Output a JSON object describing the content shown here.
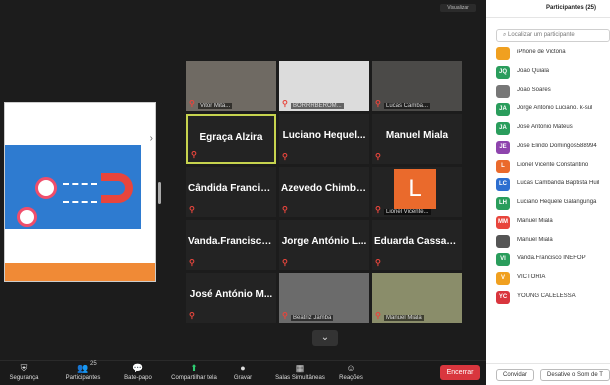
{
  "window": {
    "top_badge": "Visualizar"
  },
  "tiles": [
    {
      "name": "",
      "label": "Vitor Mita...",
      "type": "photo"
    },
    {
      "name": "",
      "label": "BORRRBEROM...",
      "type": "photo"
    },
    {
      "name": "",
      "label": "Lucas Camba...",
      "type": "photo"
    },
    {
      "name": "Egraça Alzira",
      "label": "",
      "type": "text"
    },
    {
      "name": "Luciano  Hequel...",
      "label": "",
      "type": "text"
    },
    {
      "name": "Manuel Miala",
      "label": "",
      "type": "text"
    },
    {
      "name": "Cândida Francisco",
      "label": "",
      "type": "text"
    },
    {
      "name": "Azevedo Chimbau",
      "label": "",
      "type": "text"
    },
    {
      "name": "",
      "label": "Lionel Vicente...",
      "type": "avatar",
      "initial": "L"
    },
    {
      "name": "Vanda.Francisco...",
      "label": "",
      "type": "text"
    },
    {
      "name": "Jorge António L...",
      "label": "",
      "type": "text"
    },
    {
      "name": "Eduarda Cassange",
      "label": "",
      "type": "text"
    },
    {
      "name": "José António M...",
      "label": "",
      "type": "text"
    },
    {
      "name": "",
      "label": "Beatriz Jamba",
      "type": "photo"
    },
    {
      "name": "",
      "label": "Manuel Miala",
      "type": "photo"
    }
  ],
  "toolbar": {
    "items": [
      {
        "label": "Segurança",
        "icon": "shield-icon",
        "glyph": "⛨"
      },
      {
        "label": "Participantes",
        "icon": "participants-icon",
        "glyph": "👥",
        "count": "25"
      },
      {
        "label": "Bate-papo",
        "icon": "chat-icon",
        "glyph": "💬"
      },
      {
        "label": "Compartilhar tela",
        "icon": "share-screen-icon",
        "glyph": "⬆"
      },
      {
        "label": "Gravar",
        "icon": "record-icon",
        "glyph": "●"
      },
      {
        "label": "Salas Simultâneas",
        "icon": "breakout-icon",
        "glyph": "▦"
      },
      {
        "label": "Reações",
        "icon": "reactions-icon",
        "glyph": "☺"
      }
    ],
    "end_label": "Encerrar"
  },
  "panel": {
    "title": "Participantes (25)",
    "search_placeholder": "Localizar um participante",
    "participants": [
      {
        "initials": "",
        "name": "iPhone de Victoria",
        "color": "#f0a020"
      },
      {
        "initials": "JQ",
        "name": "João Quiala",
        "color": "#2a9d5c"
      },
      {
        "initials": "",
        "name": "João Soares",
        "color": "#777777"
      },
      {
        "initials": "JA",
        "name": "Jorge António Luciano. k-sul",
        "color": "#2a9d5c"
      },
      {
        "initials": "JA",
        "name": "José António Mateus",
        "color": "#2a9d5c"
      },
      {
        "initials": "JE",
        "name": "José Elindo Domingos588994",
        "color": "#8e44ad"
      },
      {
        "initials": "L",
        "name": "Lionel Vicente Constantino",
        "color": "#ea6a2c"
      },
      {
        "initials": "LC",
        "name": "Lucas Cambanda Baptista Huil",
        "color": "#2d6fd0"
      },
      {
        "initials": "LH",
        "name": "Luciano Hequele Galangunga",
        "color": "#2a9d5c"
      },
      {
        "initials": "MM",
        "name": "Manuel Miala",
        "color": "#e8453c"
      },
      {
        "initials": "",
        "name": "Manuel Miala",
        "color": "#555555"
      },
      {
        "initials": "VI",
        "name": "Vanda.Francisco INEFOP",
        "color": "#2a9d5c"
      },
      {
        "initials": "V",
        "name": "VICTÓRIA",
        "color": "#f0a020"
      },
      {
        "initials": "YC",
        "name": "YOUNG CALELESSA",
        "color": "#d9363e"
      }
    ],
    "invite_label": "Convidar",
    "mute_all_label": "Desative o Som de T"
  }
}
